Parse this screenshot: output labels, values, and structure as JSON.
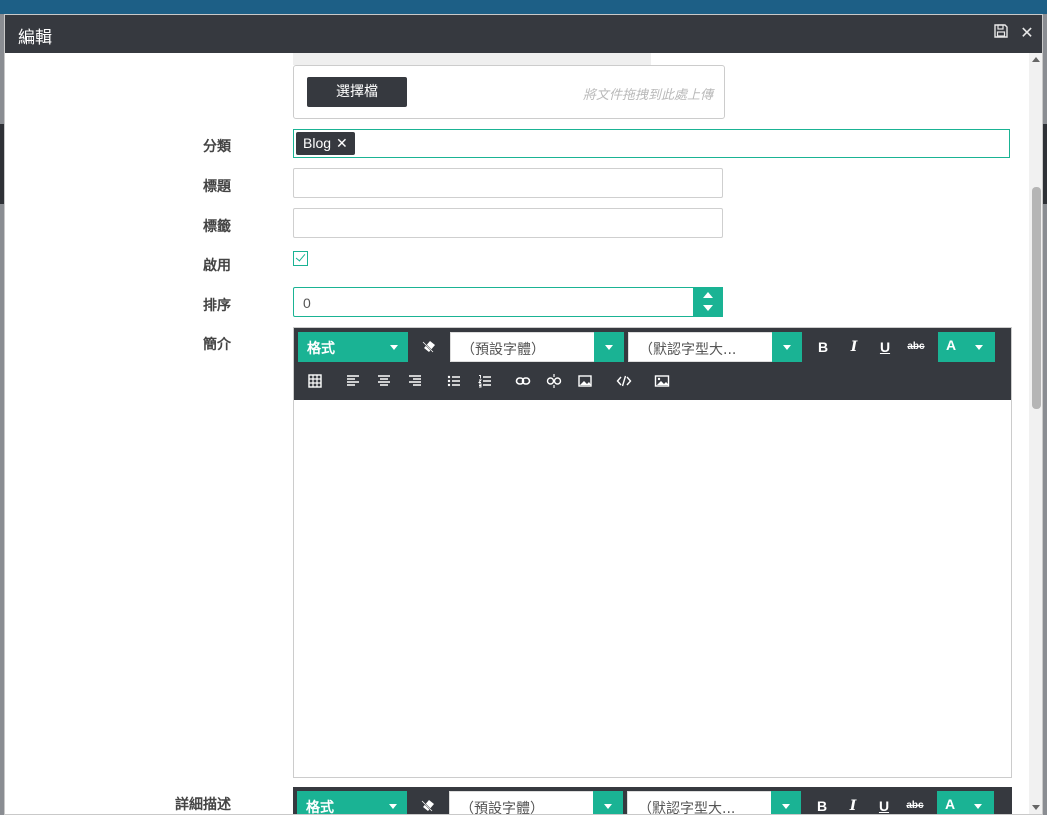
{
  "dialog": {
    "title": "編輯",
    "save_icon": "save-icon",
    "close_icon": "close-icon"
  },
  "uploader": {
    "button_label": "選擇檔",
    "drop_hint": "將文件拖拽到此處上傳"
  },
  "fields": {
    "category_label": "分類",
    "category_tags": [
      "Blog"
    ],
    "title_label": "標題",
    "title_value": "",
    "tags_label": "標籤",
    "tags_value": "",
    "enabled_label": "啟用",
    "enabled_checked": true,
    "order_label": "排序",
    "order_value": "0",
    "summary_label": "簡介",
    "details_label": "詳細描述"
  },
  "editor": {
    "format_label": "格式",
    "font_placeholder": "（預設字體）",
    "size_placeholder": "（默認字型大...",
    "bold": "B",
    "italic": "I",
    "underline": "U",
    "strike": "abc",
    "color": "A",
    "row2_tools": [
      "table-icon",
      "align-left-icon",
      "align-center-icon",
      "align-right-icon",
      "unordered-list-icon",
      "ordered-list-icon",
      "link-icon",
      "unlink-icon",
      "image-icon",
      "code-view-icon",
      "picture-icon"
    ]
  },
  "colors": {
    "accent": "#1ab394",
    "dark": "#36393f",
    "header_bg": "#1d5f86"
  }
}
